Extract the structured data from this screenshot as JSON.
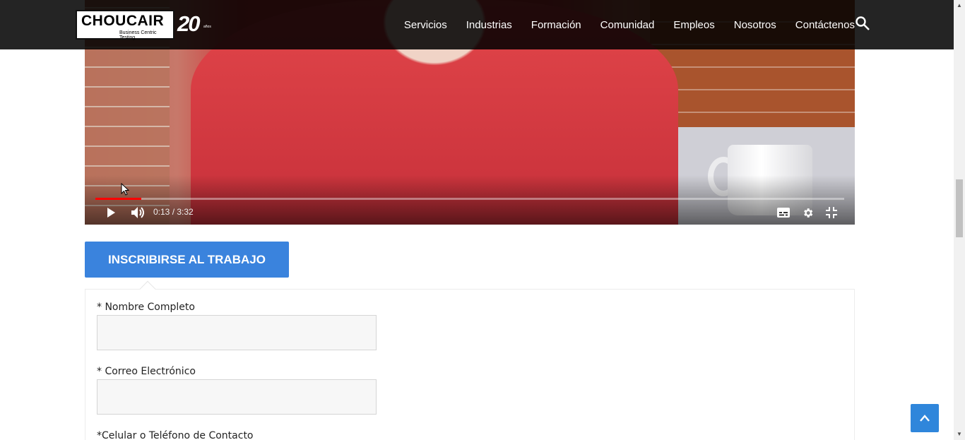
{
  "header": {
    "logo": {
      "wordmark": "CHOUCAIR",
      "tagline": "Business Centric Testing",
      "anniversary": "20",
      "anniversary_small": "años"
    },
    "nav": [
      "Servicios",
      "Industrias",
      "Formación",
      "Comunidad",
      "Empleos",
      "Nosotros",
      "Contáctenos"
    ],
    "search_icon": "search-icon"
  },
  "video": {
    "progress": 0.061,
    "current_time": "0:13",
    "duration": "3:32",
    "time_display": "0:13 / 3:32",
    "icons": [
      "play-icon",
      "volume-icon",
      "subtitles-icon",
      "settings-icon",
      "exit-fullscreen-icon"
    ]
  },
  "apply": {
    "tab_label": "INSCRIBIRSE AL TRABAJO"
  },
  "form": {
    "fields": [
      {
        "label": "* Nombre Completo",
        "value": ""
      },
      {
        "label": "* Correo Electrónico",
        "value": ""
      },
      {
        "label": "*Celular o Teléfono de Contacto",
        "value": ""
      }
    ]
  },
  "colors": {
    "accent": "#3a83dd",
    "header_bg": "#111111",
    "progress": "#ff0000"
  }
}
